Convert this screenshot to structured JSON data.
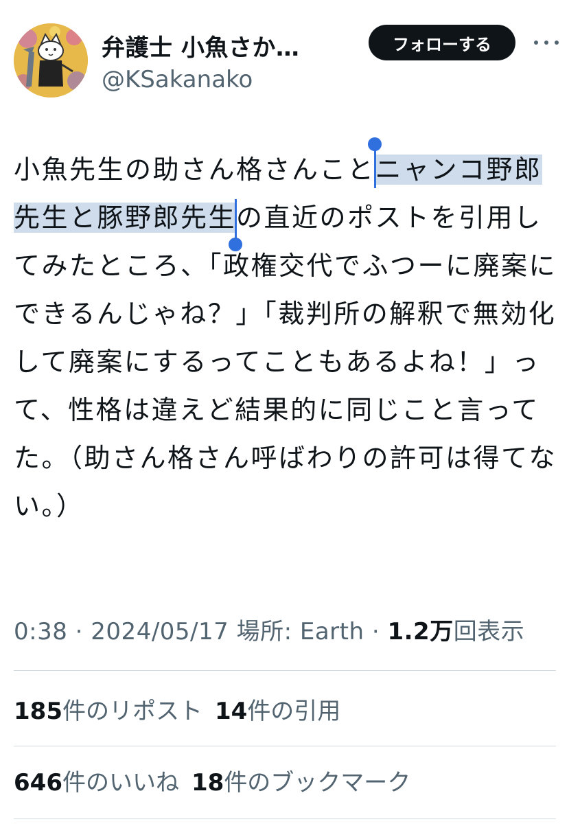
{
  "author": {
    "display_name": "弁護士 小魚さか…",
    "handle": "@KSakanako",
    "avatar_icon": "cat-with-fish-avatar-icon"
  },
  "actions": {
    "follow_label": "フォローする",
    "more_icon": "more-horizontal-icon"
  },
  "tweet": {
    "text_before": "小魚先生の助さん格さんこと",
    "text_selected": "ニャンコ野郎先生と豚野郎先生",
    "text_after": "の直近のポストを引用してみたところ、「政権交代でふつーに廃案にできるんじゃね？」「裁判所の解釈で無効化して廃案にするってこともあるよね！」って、性格は違えど結果的に同じこと言ってた。（助さん格さん呼ばわりの許可は得てない。）"
  },
  "meta": {
    "time": "0:38",
    "separator": "·",
    "date": "2024/05/17",
    "location": "場所: Earth",
    "views_count": "1.2万",
    "views_label": "回表示"
  },
  "stats": {
    "reposts_count": "185",
    "reposts_label": "件のリポスト",
    "quotes_count": "14",
    "quotes_label": "件の引用",
    "likes_count": "646",
    "likes_label": "件のいいね",
    "bookmarks_count": "18",
    "bookmarks_label": "件のブックマーク"
  },
  "colors": {
    "selection": "#cfdcec",
    "selection_handle": "#2f6fde",
    "secondary_text": "#536471",
    "primary_text": "#0f1419",
    "divider": "#cfd9de"
  }
}
